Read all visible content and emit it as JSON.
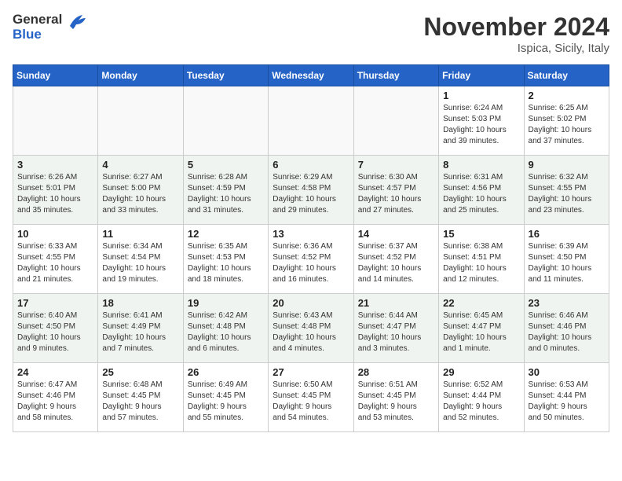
{
  "logo": {
    "general": "General",
    "blue": "Blue"
  },
  "header": {
    "month": "November 2024",
    "location": "Ispica, Sicily, Italy"
  },
  "days_of_week": [
    "Sunday",
    "Monday",
    "Tuesday",
    "Wednesday",
    "Thursday",
    "Friday",
    "Saturday"
  ],
  "weeks": [
    [
      {
        "day": "",
        "info": ""
      },
      {
        "day": "",
        "info": ""
      },
      {
        "day": "",
        "info": ""
      },
      {
        "day": "",
        "info": ""
      },
      {
        "day": "",
        "info": ""
      },
      {
        "day": "1",
        "info": "Sunrise: 6:24 AM\nSunset: 5:03 PM\nDaylight: 10 hours\nand 39 minutes."
      },
      {
        "day": "2",
        "info": "Sunrise: 6:25 AM\nSunset: 5:02 PM\nDaylight: 10 hours\nand 37 minutes."
      }
    ],
    [
      {
        "day": "3",
        "info": "Sunrise: 6:26 AM\nSunset: 5:01 PM\nDaylight: 10 hours\nand 35 minutes."
      },
      {
        "day": "4",
        "info": "Sunrise: 6:27 AM\nSunset: 5:00 PM\nDaylight: 10 hours\nand 33 minutes."
      },
      {
        "day": "5",
        "info": "Sunrise: 6:28 AM\nSunset: 4:59 PM\nDaylight: 10 hours\nand 31 minutes."
      },
      {
        "day": "6",
        "info": "Sunrise: 6:29 AM\nSunset: 4:58 PM\nDaylight: 10 hours\nand 29 minutes."
      },
      {
        "day": "7",
        "info": "Sunrise: 6:30 AM\nSunset: 4:57 PM\nDaylight: 10 hours\nand 27 minutes."
      },
      {
        "day": "8",
        "info": "Sunrise: 6:31 AM\nSunset: 4:56 PM\nDaylight: 10 hours\nand 25 minutes."
      },
      {
        "day": "9",
        "info": "Sunrise: 6:32 AM\nSunset: 4:55 PM\nDaylight: 10 hours\nand 23 minutes."
      }
    ],
    [
      {
        "day": "10",
        "info": "Sunrise: 6:33 AM\nSunset: 4:55 PM\nDaylight: 10 hours\nand 21 minutes."
      },
      {
        "day": "11",
        "info": "Sunrise: 6:34 AM\nSunset: 4:54 PM\nDaylight: 10 hours\nand 19 minutes."
      },
      {
        "day": "12",
        "info": "Sunrise: 6:35 AM\nSunset: 4:53 PM\nDaylight: 10 hours\nand 18 minutes."
      },
      {
        "day": "13",
        "info": "Sunrise: 6:36 AM\nSunset: 4:52 PM\nDaylight: 10 hours\nand 16 minutes."
      },
      {
        "day": "14",
        "info": "Sunrise: 6:37 AM\nSunset: 4:52 PM\nDaylight: 10 hours\nand 14 minutes."
      },
      {
        "day": "15",
        "info": "Sunrise: 6:38 AM\nSunset: 4:51 PM\nDaylight: 10 hours\nand 12 minutes."
      },
      {
        "day": "16",
        "info": "Sunrise: 6:39 AM\nSunset: 4:50 PM\nDaylight: 10 hours\nand 11 minutes."
      }
    ],
    [
      {
        "day": "17",
        "info": "Sunrise: 6:40 AM\nSunset: 4:50 PM\nDaylight: 10 hours\nand 9 minutes."
      },
      {
        "day": "18",
        "info": "Sunrise: 6:41 AM\nSunset: 4:49 PM\nDaylight: 10 hours\nand 7 minutes."
      },
      {
        "day": "19",
        "info": "Sunrise: 6:42 AM\nSunset: 4:48 PM\nDaylight: 10 hours\nand 6 minutes."
      },
      {
        "day": "20",
        "info": "Sunrise: 6:43 AM\nSunset: 4:48 PM\nDaylight: 10 hours\nand 4 minutes."
      },
      {
        "day": "21",
        "info": "Sunrise: 6:44 AM\nSunset: 4:47 PM\nDaylight: 10 hours\nand 3 minutes."
      },
      {
        "day": "22",
        "info": "Sunrise: 6:45 AM\nSunset: 4:47 PM\nDaylight: 10 hours\nand 1 minute."
      },
      {
        "day": "23",
        "info": "Sunrise: 6:46 AM\nSunset: 4:46 PM\nDaylight: 10 hours\nand 0 minutes."
      }
    ],
    [
      {
        "day": "24",
        "info": "Sunrise: 6:47 AM\nSunset: 4:46 PM\nDaylight: 9 hours\nand 58 minutes."
      },
      {
        "day": "25",
        "info": "Sunrise: 6:48 AM\nSunset: 4:45 PM\nDaylight: 9 hours\nand 57 minutes."
      },
      {
        "day": "26",
        "info": "Sunrise: 6:49 AM\nSunset: 4:45 PM\nDaylight: 9 hours\nand 55 minutes."
      },
      {
        "day": "27",
        "info": "Sunrise: 6:50 AM\nSunset: 4:45 PM\nDaylight: 9 hours\nand 54 minutes."
      },
      {
        "day": "28",
        "info": "Sunrise: 6:51 AM\nSunset: 4:45 PM\nDaylight: 9 hours\nand 53 minutes."
      },
      {
        "day": "29",
        "info": "Sunrise: 6:52 AM\nSunset: 4:44 PM\nDaylight: 9 hours\nand 52 minutes."
      },
      {
        "day": "30",
        "info": "Sunrise: 6:53 AM\nSunset: 4:44 PM\nDaylight: 9 hours\nand 50 minutes."
      }
    ]
  ]
}
